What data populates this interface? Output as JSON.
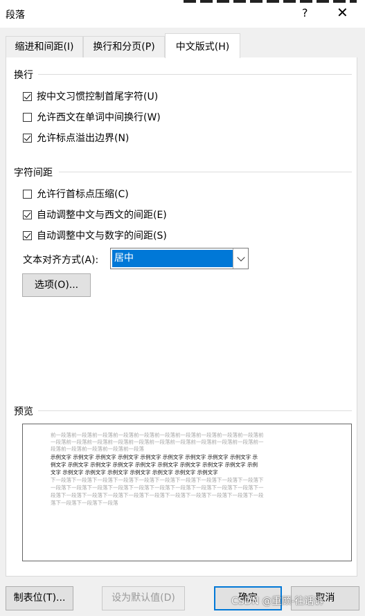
{
  "window": {
    "title": "段落",
    "help_label": "?",
    "close_label": "✕"
  },
  "tabs": [
    {
      "label": "缩进和间距(I)",
      "active": false
    },
    {
      "label": "换行和分页(P)",
      "active": false
    },
    {
      "label": "中文版式(H)",
      "active": true
    }
  ],
  "line_break": {
    "title": "换行",
    "options": [
      {
        "label": "按中文习惯控制首尾字符(U)",
        "checked": true
      },
      {
        "label": "允许西文在单词中间换行(W)",
        "checked": false
      },
      {
        "label": "允许标点溢出边界(N)",
        "checked": true
      }
    ]
  },
  "char_spacing": {
    "title": "字符间距",
    "options": [
      {
        "label": "允许行首标点压缩(C)",
        "checked": false
      },
      {
        "label": "自动调整中文与西文的间距(E)",
        "checked": true
      },
      {
        "label": "自动调整中文与数字的间距(S)",
        "checked": true
      }
    ],
    "align_label": "文本对齐方式(A):",
    "align_value": "居中",
    "options_button": "选项(O)..."
  },
  "preview": {
    "title": "预览",
    "lines": [
      {
        "text": "前一段落前一段落前一段落前一段落前一段落前一段落前一段落前一段落前一段落前一段落前",
        "style": "gray"
      },
      {
        "text": "一段落前一段落前一段落前一段落前一段落前一段落前一段落前一段落前一段落前一段落前一",
        "style": "gray"
      },
      {
        "text": "段落前一段落前一段落前一段落前一段落",
        "style": "gray"
      },
      {
        "text": "示例文字 示例文字 示例文字 示例文字 示例文字 示例文字 示例文字 示例文字 示例文字 示",
        "style": "black"
      },
      {
        "text": "例文字 示例文字 示例文字 示例文字 示例文字 示例文字 示例文字 示例文字 示例文字 示例",
        "style": "black"
      },
      {
        "text": "文字 示例文字 示例文字 示例文字 示例文字 示例文字 示例文字 示例文字",
        "style": "black"
      },
      {
        "text": "下一段落下一段落下一段落下一段落下一段落下一段落下一段落下一段落下一段落下一段落下",
        "style": "gray"
      },
      {
        "text": "一段落下一段落下一段落下一段落下一段落下一段落下一段落下一段落下一段落下一段落下一",
        "style": "gray"
      },
      {
        "text": "段落下一段落下一段落下一段落下一段落下一段落下一段落下一段落下一段落下一段落下一段",
        "style": "gray"
      },
      {
        "text": "落下一段落下一段落下一段落",
        "style": "gray"
      }
    ]
  },
  "footer": {
    "tabs_button": "制表位(T)...",
    "default_button": "设为默认值(D)",
    "ok_button": "确定",
    "cancel_button": "取消"
  },
  "watermark": "CSDN @重顾-往话诉"
}
